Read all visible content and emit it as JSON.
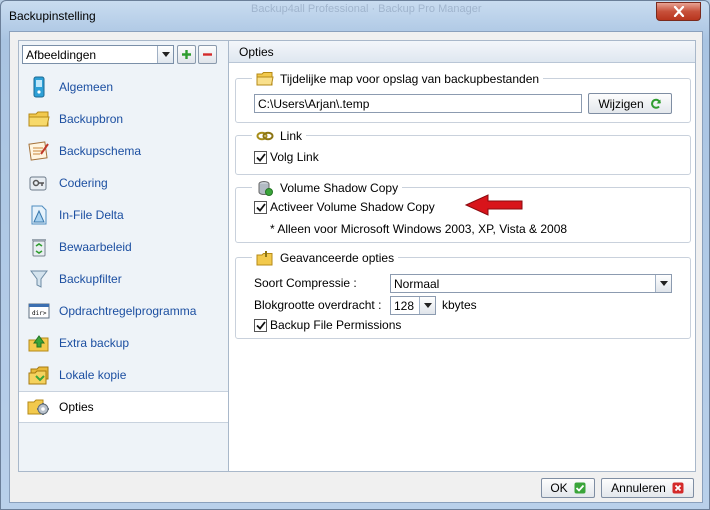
{
  "window": {
    "title": "Backupinstelling",
    "ghost_title": "Backup4all Professional · Backup Pro Manager"
  },
  "left": {
    "profile_select": "Afbeeldingen",
    "nav": [
      {
        "label": "Algemeen",
        "icon": "phone-icon"
      },
      {
        "label": "Backupbron",
        "icon": "folder-icon"
      },
      {
        "label": "Backupschema",
        "icon": "calendar-icon"
      },
      {
        "label": "Codering",
        "icon": "key-icon"
      },
      {
        "label": "In-File Delta",
        "icon": "document-icon"
      },
      {
        "label": "Bewaarbeleid",
        "icon": "recycle-bin-icon"
      },
      {
        "label": "Backupfilter",
        "icon": "funnel-icon"
      },
      {
        "label": "Opdrachtregelprogramma",
        "icon": "command-prompt-icon"
      },
      {
        "label": "Extra backup",
        "icon": "folder-arrow-icon"
      },
      {
        "label": "Lokale kopie",
        "icon": "folder-copy-icon"
      },
      {
        "label": "Opties",
        "icon": "gears-icon"
      }
    ]
  },
  "panel": {
    "title": "Opties",
    "temp": {
      "title": "Tijdelijke map voor opslag van backupbestanden",
      "path": "C:\\Users\\Arjan\\.temp",
      "change_button": "Wijzigen"
    },
    "link": {
      "title": "Link",
      "follow_label": "Volg Link",
      "follow_checked": true
    },
    "vss": {
      "title": "Volume Shadow Copy",
      "activate_label": "Activeer Volume Shadow Copy",
      "activate_checked": true,
      "note": "* Alleen voor Microsoft Windows 2003, XP, Vista & 2008"
    },
    "advanced": {
      "title": "Geavanceerde opties",
      "compression_label": "Soort Compressie :",
      "compression_value": "Normaal",
      "block_label": "Blokgrootte overdracht :",
      "block_value": "128",
      "block_unit": "kbytes",
      "permissions_label": "Backup File Permissions",
      "permissions_checked": true
    }
  },
  "footer": {
    "ok": "OK",
    "cancel": "Annuleren"
  },
  "colors": {
    "nav_link": "#1c4fa1",
    "arrow": "#d8141b",
    "ok_green": "#3aa53a",
    "cancel_red": "#d42a2a"
  }
}
